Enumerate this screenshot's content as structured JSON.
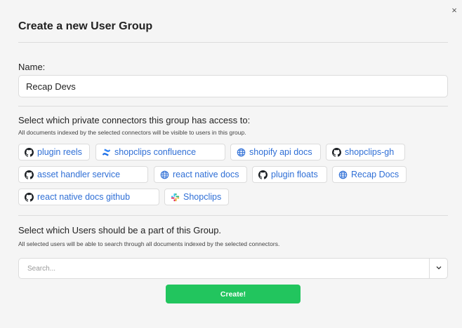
{
  "dialog": {
    "title": "Create a new User Group",
    "close_glyph": "×"
  },
  "name_field": {
    "label": "Name:",
    "value": "Recap Devs"
  },
  "connectors": {
    "heading": "Select which private connectors this group has access to:",
    "description": "All documents indexed by the selected connectors will be visible to users in this group.",
    "accent_color": "#2f6fd6",
    "items": [
      {
        "label": "plugin reels",
        "icon": "github-icon"
      },
      {
        "label": "shopclips confluence",
        "icon": "confluence-icon"
      },
      {
        "label": "shopify api docs",
        "icon": "globe-icon"
      },
      {
        "label": "shopclips-gh",
        "icon": "github-icon"
      },
      {
        "label": "asset handler service",
        "icon": "github-icon"
      },
      {
        "label": "react native docs",
        "icon": "globe-icon"
      },
      {
        "label": "plugin floats",
        "icon": "github-icon"
      },
      {
        "label": "Recap Docs",
        "icon": "globe-icon"
      },
      {
        "label": "react native docs github",
        "icon": "github-icon"
      },
      {
        "label": "Shopclips",
        "icon": "slack-icon"
      }
    ]
  },
  "users": {
    "heading": "Select which Users should be a part of this Group.",
    "description": "All selected users will be able to search through all documents indexed by the selected connectors.",
    "search_placeholder": "Search...",
    "dropdown_icon": "chevron-down-icon"
  },
  "submit": {
    "label": "Create!",
    "color": "#22c55e"
  }
}
